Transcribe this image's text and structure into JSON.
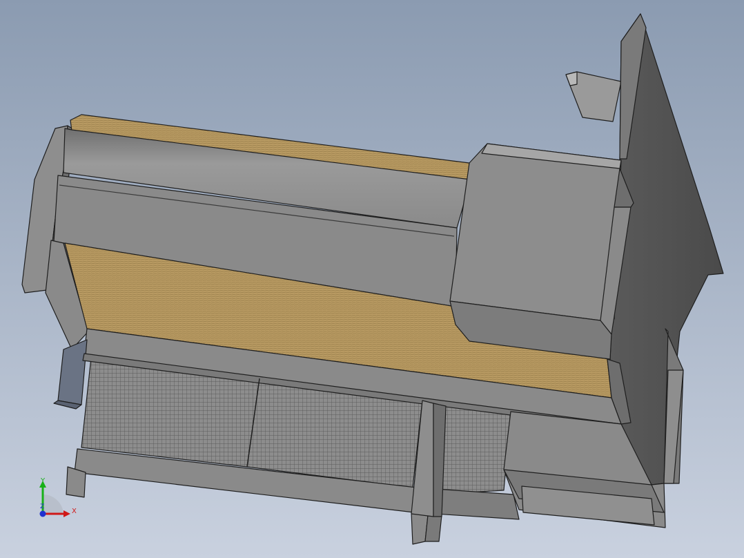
{
  "viewport": {
    "background_top": "#8b9bb1",
    "background_bottom": "#c9d1df"
  },
  "model": {
    "body_color": "#8a8a8a",
    "dark_panel_color": "#555555",
    "wood_color": "#b89a62",
    "mesh_color": "#7f7f7f",
    "edge_color": "#1e1e1e"
  },
  "triad": {
    "x_label": "X",
    "y_label": "Y",
    "z_label": "Z",
    "x_color": "#d01818",
    "y_color": "#18b018",
    "z_color": "#2030d0"
  }
}
